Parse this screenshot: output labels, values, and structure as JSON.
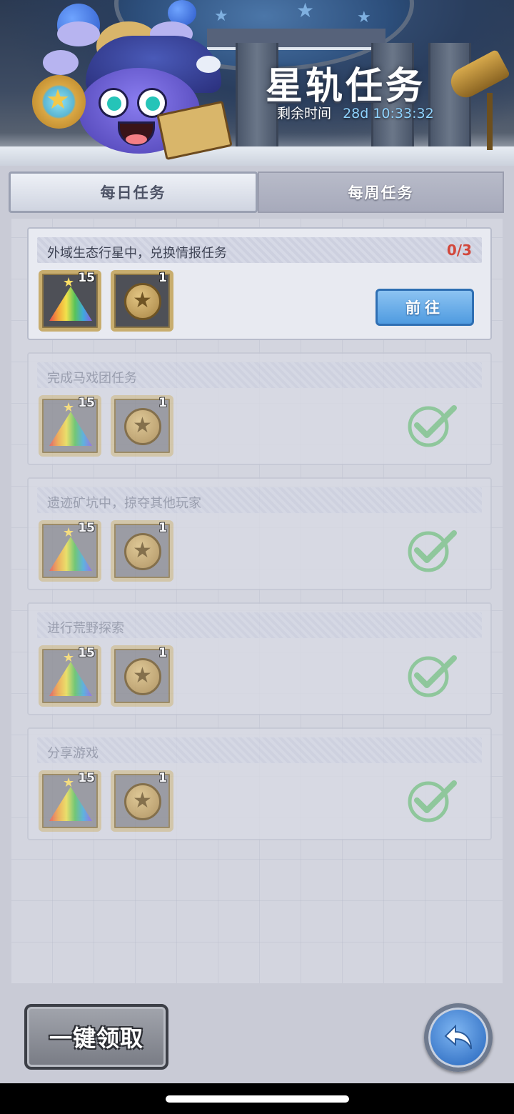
{
  "header": {
    "title": "星轨任务",
    "time_label": "剩余时间",
    "time_value": "28d 10:33:32"
  },
  "tabs": [
    {
      "label": "每日任务",
      "selected": true
    },
    {
      "label": "每周任务",
      "selected": false
    }
  ],
  "tasks": [
    {
      "title": "外域生态行星中，兑换情报任务",
      "progress": "0/3",
      "status": "in-progress",
      "action_label": "前往",
      "rewards": [
        {
          "icon": "rainbow-sand-icon",
          "count": "15"
        },
        {
          "icon": "star-coin-icon",
          "count": "1"
        }
      ]
    },
    {
      "title": "完成马戏团任务",
      "status": "completed",
      "rewards": [
        {
          "icon": "rainbow-sand-icon",
          "count": "15"
        },
        {
          "icon": "star-coin-icon",
          "count": "1"
        }
      ]
    },
    {
      "title": "遗迹矿坑中，掠夺其他玩家",
      "status": "completed",
      "rewards": [
        {
          "icon": "rainbow-sand-icon",
          "count": "15"
        },
        {
          "icon": "star-coin-icon",
          "count": "1"
        }
      ]
    },
    {
      "title": "进行荒野探索",
      "status": "completed",
      "rewards": [
        {
          "icon": "rainbow-sand-icon",
          "count": "15"
        },
        {
          "icon": "star-coin-icon",
          "count": "1"
        }
      ]
    },
    {
      "title": "分享游戏",
      "status": "completed",
      "rewards": [
        {
          "icon": "rainbow-sand-icon",
          "count": "15"
        },
        {
          "icon": "star-coin-icon",
          "count": "1"
        }
      ]
    }
  ],
  "footer": {
    "claim_all_label": "一键领取",
    "back_icon": "back-arrow-icon"
  },
  "colors": {
    "progress_red": "#d2473b",
    "go_button_blue": "#4f9be0",
    "check_green": "#7cc48a",
    "time_value_blue": "#8fd3ff"
  }
}
